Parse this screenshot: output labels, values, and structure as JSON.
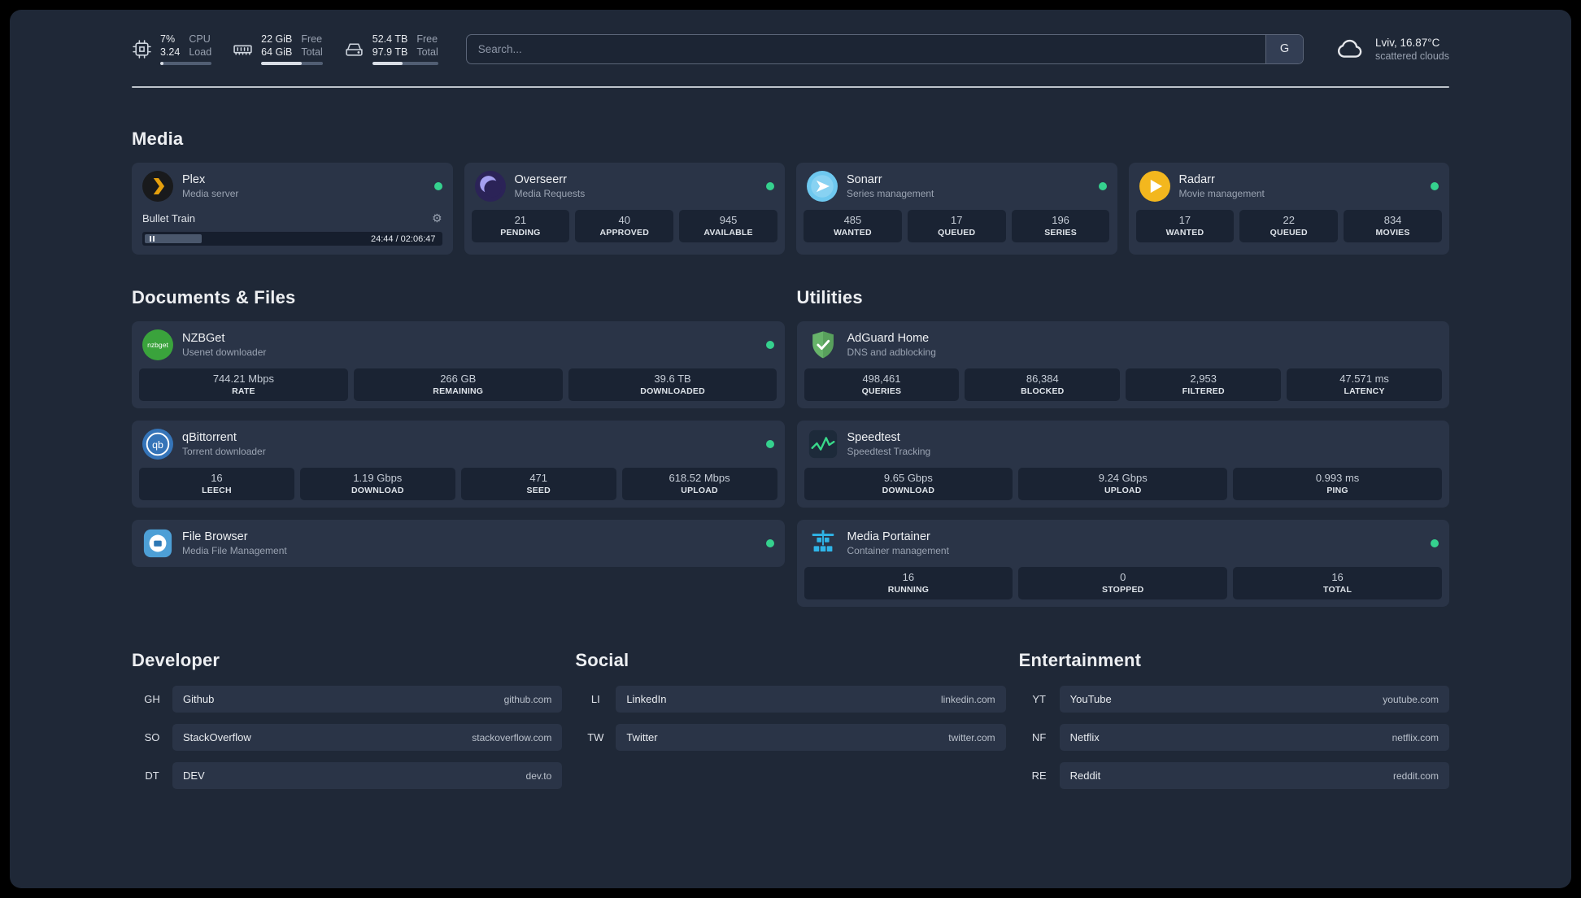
{
  "colors": {
    "background": "#1f2837",
    "card": "#2a3447",
    "stat_box": "#1a2333",
    "status_dot": "#35d18e",
    "plex_amber": "#e5a00d",
    "adguard_green": "#67b36a",
    "portainer_blue": "#2fb5e8",
    "speedtest_line_green": "#39d98a"
  },
  "icons": {
    "gear": "⚙"
  },
  "header": {
    "resources": [
      {
        "value_top": "7%",
        "value_bottom": "3.24",
        "label_top": "CPU",
        "label_bottom": "Load",
        "percent": 7
      },
      {
        "value_top": "22 GiB",
        "value_bottom": "64 GiB",
        "label_top": "Free",
        "label_bottom": "Total",
        "percent": 66
      },
      {
        "value_top": "52.4 TB",
        "value_bottom": "97.9 TB",
        "label_top": "Free",
        "label_bottom": "Total",
        "percent": 46
      }
    ],
    "search": {
      "placeholder": "Search...",
      "provider_label": "G"
    },
    "weather": {
      "location": "Lviv, 16.87°C",
      "condition": "scattered clouds"
    }
  },
  "groups": {
    "media": {
      "title": "Media",
      "plex": {
        "name": "Plex",
        "subtitle": "Media server",
        "now_playing": "Bullet Train",
        "time": "24:44 / 02:06:47",
        "progress_percent": 19
      },
      "overseerr": {
        "name": "Overseerr",
        "subtitle": "Media Requests",
        "stats": [
          {
            "value": "21",
            "label": "PENDING"
          },
          {
            "value": "40",
            "label": "APPROVED"
          },
          {
            "value": "945",
            "label": "AVAILABLE"
          }
        ]
      },
      "sonarr": {
        "name": "Sonarr",
        "subtitle": "Series management",
        "stats": [
          {
            "value": "485",
            "label": "WANTED"
          },
          {
            "value": "17",
            "label": "QUEUED"
          },
          {
            "value": "196",
            "label": "SERIES"
          }
        ]
      },
      "radarr": {
        "name": "Radarr",
        "subtitle": "Movie management",
        "stats": [
          {
            "value": "17",
            "label": "WANTED"
          },
          {
            "value": "22",
            "label": "QUEUED"
          },
          {
            "value": "834",
            "label": "MOVIES"
          }
        ]
      }
    },
    "documents": {
      "title": "Documents & Files",
      "nzbget": {
        "name": "NZBGet",
        "subtitle": "Usenet downloader",
        "icon_text": "nzbget",
        "stats": [
          {
            "value": "744.21 Mbps",
            "label": "RATE"
          },
          {
            "value": "266 GB",
            "label": "REMAINING"
          },
          {
            "value": "39.6 TB",
            "label": "DOWNLOADED"
          }
        ]
      },
      "qbittorrent": {
        "name": "qBittorrent",
        "subtitle": "Torrent downloader",
        "icon_text": "qb",
        "stats": [
          {
            "value": "16",
            "label": "LEECH"
          },
          {
            "value": "1.19 Gbps",
            "label": "DOWNLOAD"
          },
          {
            "value": "471",
            "label": "SEED"
          },
          {
            "value": "618.52 Mbps",
            "label": "UPLOAD"
          }
        ]
      },
      "filebrowser": {
        "name": "File Browser",
        "subtitle": "Media File Management"
      }
    },
    "utilities": {
      "title": "Utilities",
      "adguard": {
        "name": "AdGuard Home",
        "subtitle": "DNS and adblocking",
        "stats": [
          {
            "value": "498,461",
            "label": "QUERIES"
          },
          {
            "value": "86,384",
            "label": "BLOCKED"
          },
          {
            "value": "2,953",
            "label": "FILTERED"
          },
          {
            "value": "47.571 ms",
            "label": "LATENCY"
          }
        ]
      },
      "speedtest": {
        "name": "Speedtest",
        "subtitle": "Speedtest Tracking",
        "stats": [
          {
            "value": "9.65 Gbps",
            "label": "DOWNLOAD"
          },
          {
            "value": "9.24 Gbps",
            "label": "UPLOAD"
          },
          {
            "value": "0.993 ms",
            "label": "PING"
          }
        ]
      },
      "portainer": {
        "name": "Media Portainer",
        "subtitle": "Container management",
        "stats": [
          {
            "value": "16",
            "label": "RUNNING"
          },
          {
            "value": "0",
            "label": "STOPPED"
          },
          {
            "value": "16",
            "label": "TOTAL"
          }
        ]
      }
    },
    "bookmarks": {
      "developer": {
        "title": "Developer",
        "items": [
          {
            "abbr": "GH",
            "name": "Github",
            "url": "github.com"
          },
          {
            "abbr": "SO",
            "name": "StackOverflow",
            "url": "stackoverflow.com"
          },
          {
            "abbr": "DT",
            "name": "DEV",
            "url": "dev.to"
          }
        ]
      },
      "social": {
        "title": "Social",
        "items": [
          {
            "abbr": "LI",
            "name": "LinkedIn",
            "url": "linkedin.com"
          },
          {
            "abbr": "TW",
            "name": "Twitter",
            "url": "twitter.com"
          }
        ]
      },
      "entertainment": {
        "title": "Entertainment",
        "items": [
          {
            "abbr": "YT",
            "name": "YouTube",
            "url": "youtube.com"
          },
          {
            "abbr": "NF",
            "name": "Netflix",
            "url": "netflix.com"
          },
          {
            "abbr": "RE",
            "name": "Reddit",
            "url": "reddit.com"
          }
        ]
      }
    }
  }
}
